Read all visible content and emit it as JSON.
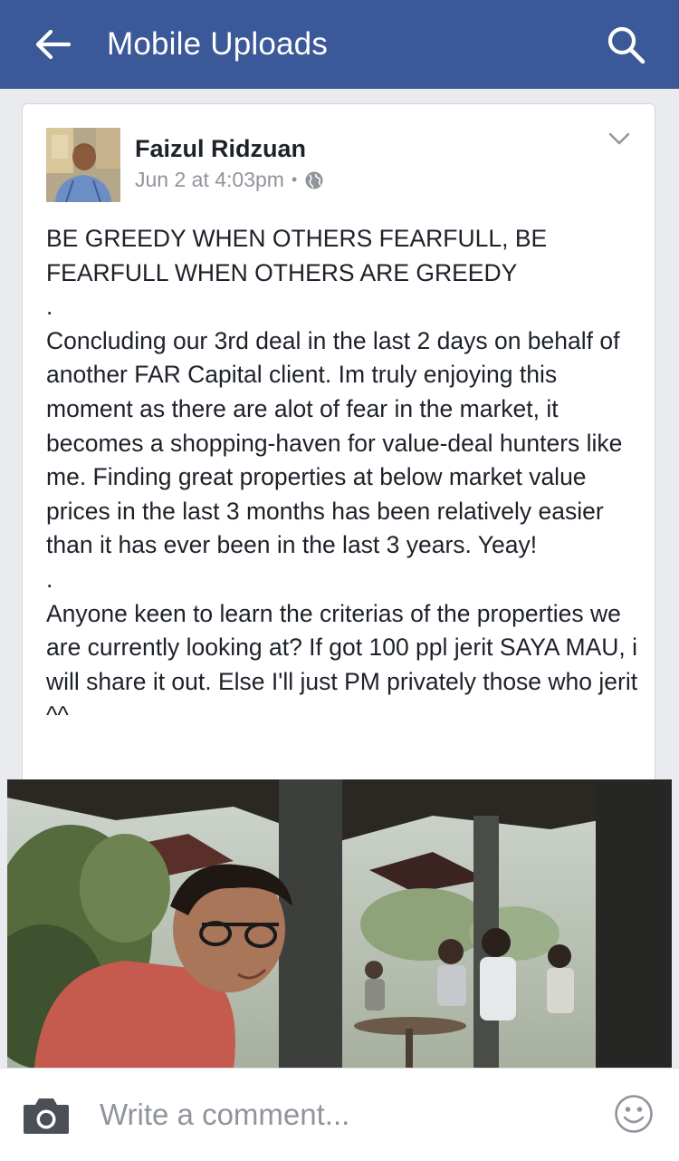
{
  "header": {
    "title": "Mobile Uploads",
    "back_icon": "back-arrow-icon",
    "search_icon": "search-icon",
    "color": "#3b5998"
  },
  "post": {
    "author": "Faizul Ridzuan",
    "timestamp": "Jun 2 at 4:03pm",
    "separator": "•",
    "privacy_icon": "globe-icon",
    "menu_icon": "chevron-down-icon",
    "paragraphs": [
      "BE GREEDY WHEN OTHERS FEARFULL, BE FEARFULL WHEN OTHERS ARE GREEDY",
      ".",
      "Concluding our 3rd deal in the last 2 days on behalf of another FAR Capital client. Im truly enjoying this moment as there are alot of fear in the market, it becomes a shopping-haven for value-deal hunters like me. Finding great properties at below market value prices in the last 3 months has been relatively easier than it has ever been in the last 3 years. Yeay!",
      ".",
      "Anyone keen to learn the criterias of the properties we are currently looking at? If got 100 ppl jerit SAYA MAU, i will share it out. Else I'll just PM privately those who jerit ^^"
    ]
  },
  "comment_bar": {
    "placeholder": "Write a comment...",
    "camera_icon": "camera-icon",
    "emoji_icon": "smiley-icon"
  }
}
